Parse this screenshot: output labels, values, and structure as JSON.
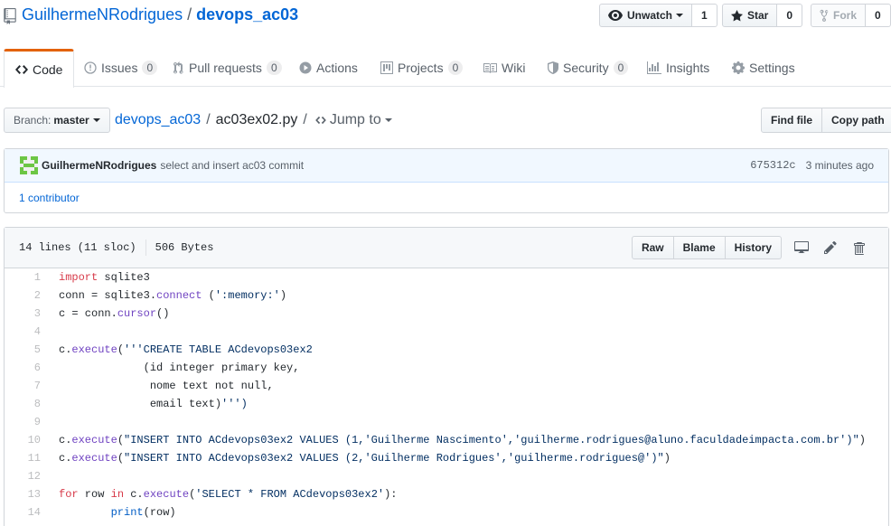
{
  "repo": {
    "owner": "GuilhermeNRodrigues",
    "separator": "/",
    "name": "devops_ac03"
  },
  "actions": {
    "watch": {
      "label": "Unwatch",
      "count": "1"
    },
    "star": {
      "label": "Star",
      "count": "0"
    },
    "fork": {
      "label": "Fork",
      "count": "0"
    }
  },
  "tabs": [
    {
      "label": "Code",
      "icon": "code-icon"
    },
    {
      "label": "Issues",
      "count": "0",
      "icon": "issue-icon"
    },
    {
      "label": "Pull requests",
      "count": "0",
      "icon": "pull-request-icon"
    },
    {
      "label": "Actions",
      "icon": "play-icon"
    },
    {
      "label": "Projects",
      "count": "0",
      "icon": "project-icon"
    },
    {
      "label": "Wiki",
      "icon": "book-icon"
    },
    {
      "label": "Security",
      "count": "0",
      "icon": "shield-icon"
    },
    {
      "label": "Insights",
      "icon": "graph-icon"
    },
    {
      "label": "Settings",
      "icon": "gear-icon"
    }
  ],
  "filenav": {
    "branch_label": "Branch:",
    "branch": "master",
    "path_repo": "devops_ac03",
    "sep": "/",
    "path_file": "ac03ex02.py",
    "jump_sep": "/",
    "jump_label": "Jump to",
    "find_file": "Find file",
    "copy_path": "Copy path"
  },
  "commit": {
    "author": "GuilhermeNRodrigues",
    "message": "select and insert ac03 commit",
    "sha": "675312c",
    "time": "3 minutes ago",
    "contributors": "1 contributor"
  },
  "file": {
    "lines_info": "14 lines (11 sloc)",
    "size": "506 Bytes",
    "raw": "Raw",
    "blame": "Blame",
    "history": "History"
  },
  "code_lines": [
    {
      "n": "1",
      "text": "import sqlite3"
    },
    {
      "n": "2",
      "text": "conn = sqlite3.connect (':memory:')"
    },
    {
      "n": "3",
      "text": "c = conn.cursor()"
    },
    {
      "n": "4",
      "text": ""
    },
    {
      "n": "5",
      "text": "c.execute('''CREATE TABLE ACdevops03ex2"
    },
    {
      "n": "6",
      "text": "             (id integer primary key,"
    },
    {
      "n": "7",
      "text": "              nome text not null,"
    },
    {
      "n": "8",
      "text": "              email text)''')"
    },
    {
      "n": "9",
      "text": ""
    },
    {
      "n": "10",
      "text": "c.execute(\"INSERT INTO ACdevops03ex2 VALUES (1,'Guilherme Nascimento','guilherme.rodrigues@aluno.faculdadeimpacta.com.br')\")"
    },
    {
      "n": "11",
      "text": "c.execute(\"INSERT INTO ACdevops03ex2 VALUES (2,'Guilherme Rodrigues','guilherme.rodrigues@')\")"
    },
    {
      "n": "12",
      "text": ""
    },
    {
      "n": "13",
      "text": "for row in c.execute('SELECT * FROM ACdevops03ex2'):"
    },
    {
      "n": "14",
      "text": "        print(row)"
    }
  ],
  "colors": {
    "link": "#0366d6",
    "tab_accent": "#e36209",
    "keyword": "#d73a49",
    "function": "#6f42c1",
    "string": "#032f62"
  }
}
